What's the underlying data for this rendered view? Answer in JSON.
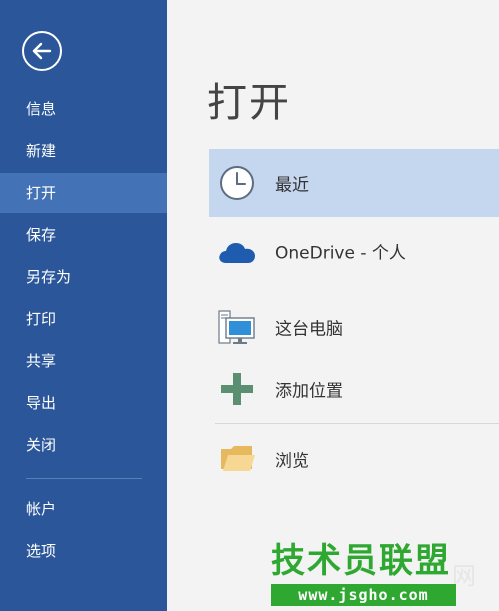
{
  "sidebar": {
    "items": [
      {
        "label": "信息"
      },
      {
        "label": "新建"
      },
      {
        "label": "打开"
      },
      {
        "label": "保存"
      },
      {
        "label": "另存为"
      },
      {
        "label": "打印"
      },
      {
        "label": "共享"
      },
      {
        "label": "导出"
      },
      {
        "label": "关闭"
      },
      {
        "label": "帐户"
      },
      {
        "label": "选项"
      }
    ],
    "back_icon": "back-arrow-icon",
    "active_item": "打开"
  },
  "main": {
    "title": "打开",
    "locations": [
      {
        "label": "最近",
        "icon": "clock-icon"
      },
      {
        "label": "OneDrive - 个人",
        "icon": "cloud-icon"
      },
      {
        "label": "这台电脑",
        "icon": "computer-icon"
      },
      {
        "label": "添加位置",
        "icon": "plus-icon"
      },
      {
        "label": "浏览",
        "icon": "folder-icon"
      }
    ]
  },
  "watermark": {
    "title": "技术员联盟",
    "suffix": "网",
    "url": "www.jsgho.com"
  },
  "colors": {
    "sidebar_bg": "#2b579a",
    "sidebar_active": "#4472b7",
    "main_bg": "#f3f3f3",
    "location_active": "#c5d6ef",
    "cloud": "#1f5cb0",
    "plus": "#5a8f72",
    "folder": "#f0c878",
    "watermark": "#2ea831"
  }
}
